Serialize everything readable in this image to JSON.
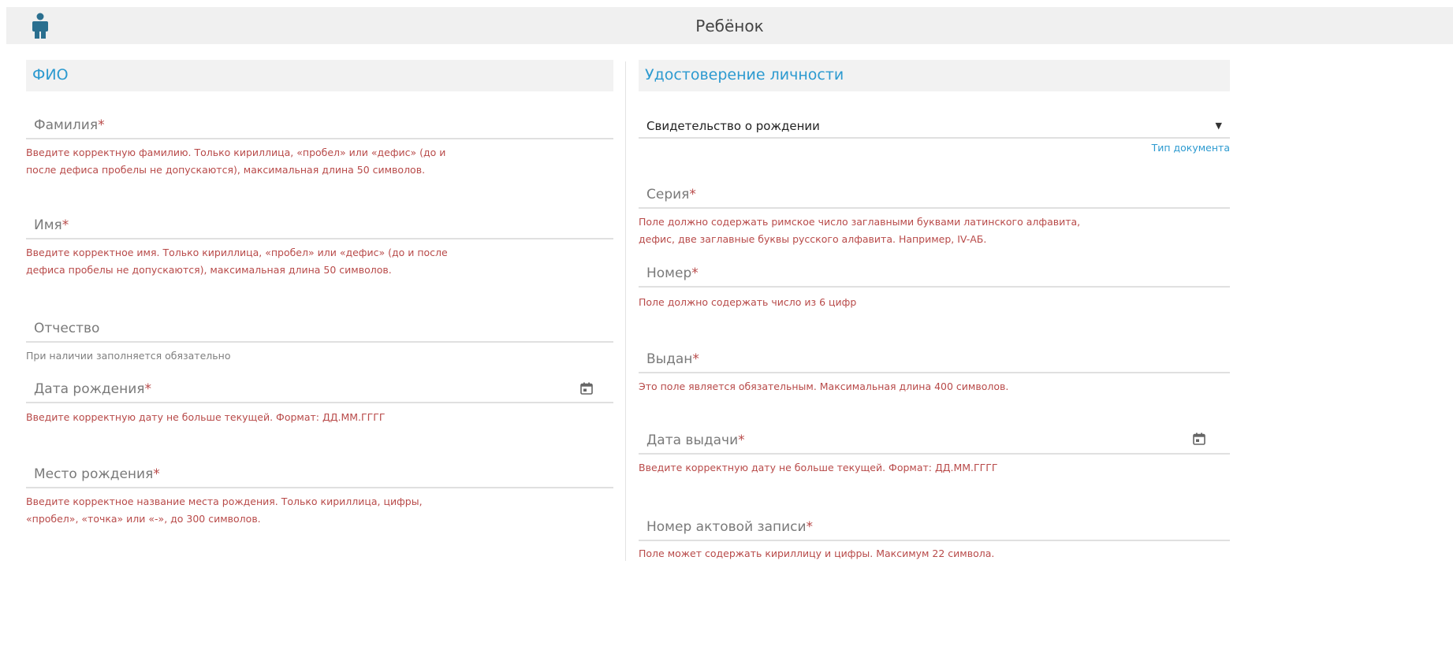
{
  "header": {
    "title": "Ребёнок",
    "icon": "child-icon"
  },
  "fio": {
    "title": "ФИО",
    "surname": {
      "label": "Фамилия",
      "required": "*",
      "error_line1": "Введите корректную фамилию. Только кириллица, «пробел» или «дефис» (до и",
      "error_line2": "после дефиса пробелы не допускаются), максимальная длина 50 символов."
    },
    "name": {
      "label": "Имя",
      "required": "*",
      "error_line1": "Введите корректное имя. Только кириллица, «пробел» или «дефис» (до и после",
      "error_line2": "дефиса пробелы не допускаются), максимальная длина 50 символов."
    },
    "patronymic": {
      "label": "Отчество",
      "hint": "При наличии заполняется обязательно"
    },
    "birth_date": {
      "label": "Дата рождения",
      "required": "*",
      "error": "Введите корректную дату не больше текущей. Формат: ДД.ММ.ГГГГ"
    },
    "birth_place": {
      "label": "Место рождения",
      "required": "*",
      "error_line1": "Введите корректное название места рождения. Только кириллица, цифры,",
      "error_line2": "«пробел», «точка» или «-», до 300 символов."
    }
  },
  "identity": {
    "title": "Удостоверение личности",
    "doc_type": {
      "value": "Свидетельство о рождении",
      "arrow": "▼",
      "caption": "Тип документа"
    },
    "series": {
      "label": "Серия",
      "required": "*",
      "error_line1": "Поле должно содержать римское число заглавными буквами латинского алфавита,",
      "error_line2": "дефис, две заглавные буквы русского алфавита. Например, IV-АБ."
    },
    "number": {
      "label": "Номер",
      "required": "*",
      "error": "Поле должно содержать число из 6 цифр"
    },
    "issued_by": {
      "label": "Выдан",
      "required": "*",
      "error": "Это поле является обязательным. Максимальная длина 400 символов."
    },
    "issue_date": {
      "label": "Дата выдачи",
      "required": "*",
      "error": "Введите корректную дату не больше текущей. Формат: ДД.ММ.ГГГГ"
    },
    "record_number": {
      "label": "Номер актовой записи",
      "required": "*",
      "error": "Поле может содержать кириллицу и цифры. Максимум 22 символа."
    }
  },
  "colors": {
    "accent": "#2c9ad0",
    "error": "#b84a49",
    "icon": "#2a6f8f"
  }
}
